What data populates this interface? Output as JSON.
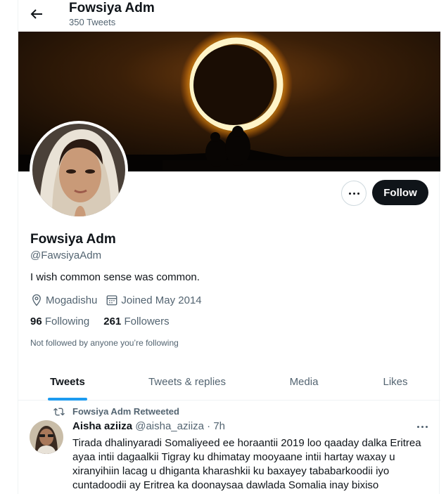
{
  "header": {
    "title": "Fowsiya Adm",
    "subtitle": "350 Tweets"
  },
  "profile": {
    "name": "Fowsiya Adm",
    "handle": "@FawsiyaAdm",
    "bio": "I wish common sense was common.",
    "location": "Mogadishu",
    "joined": "Joined May 2014",
    "following_count": "96",
    "following_label": "Following",
    "followers_count": "261",
    "followers_label": "Followers",
    "not_followed_note": "Not followed by anyone you’re following",
    "follow_button": "Follow"
  },
  "tabs": [
    {
      "label": "Tweets",
      "active": true
    },
    {
      "label": "Tweets & replies",
      "active": false
    },
    {
      "label": "Media",
      "active": false
    },
    {
      "label": "Likes",
      "active": false
    }
  ],
  "tweet": {
    "retweet_label": "Fowsiya Adm Retweeted",
    "author_name": "Aisha aziiza",
    "author_handle": "@aisha_aziiza",
    "separator": "·",
    "time": "7h",
    "text": "Tirada dhalinyaradi Somaliyeed ee horaantii 2019 loo qaaday dalka Eritrea ayaa intii dagaalkii Tigray ku dhimatay mooyaane intii hartay waxay u xiranyihiin lacag u dhiganta kharashkii ku baxayey tababarkoodii iyo cuntadoodii ay Eritrea ka doonaysaa dawlada Somalia inay bixiso"
  },
  "icons": {
    "back": "arrow-left-icon",
    "location": "location-pin-icon",
    "calendar": "calendar-icon",
    "more": "more-horizontal-icon",
    "retweet": "retweet-icon"
  },
  "colors": {
    "accent": "#1d9bf0",
    "text": "#0f1419",
    "secondary": "#536471",
    "follow_bg": "#0f1419"
  }
}
